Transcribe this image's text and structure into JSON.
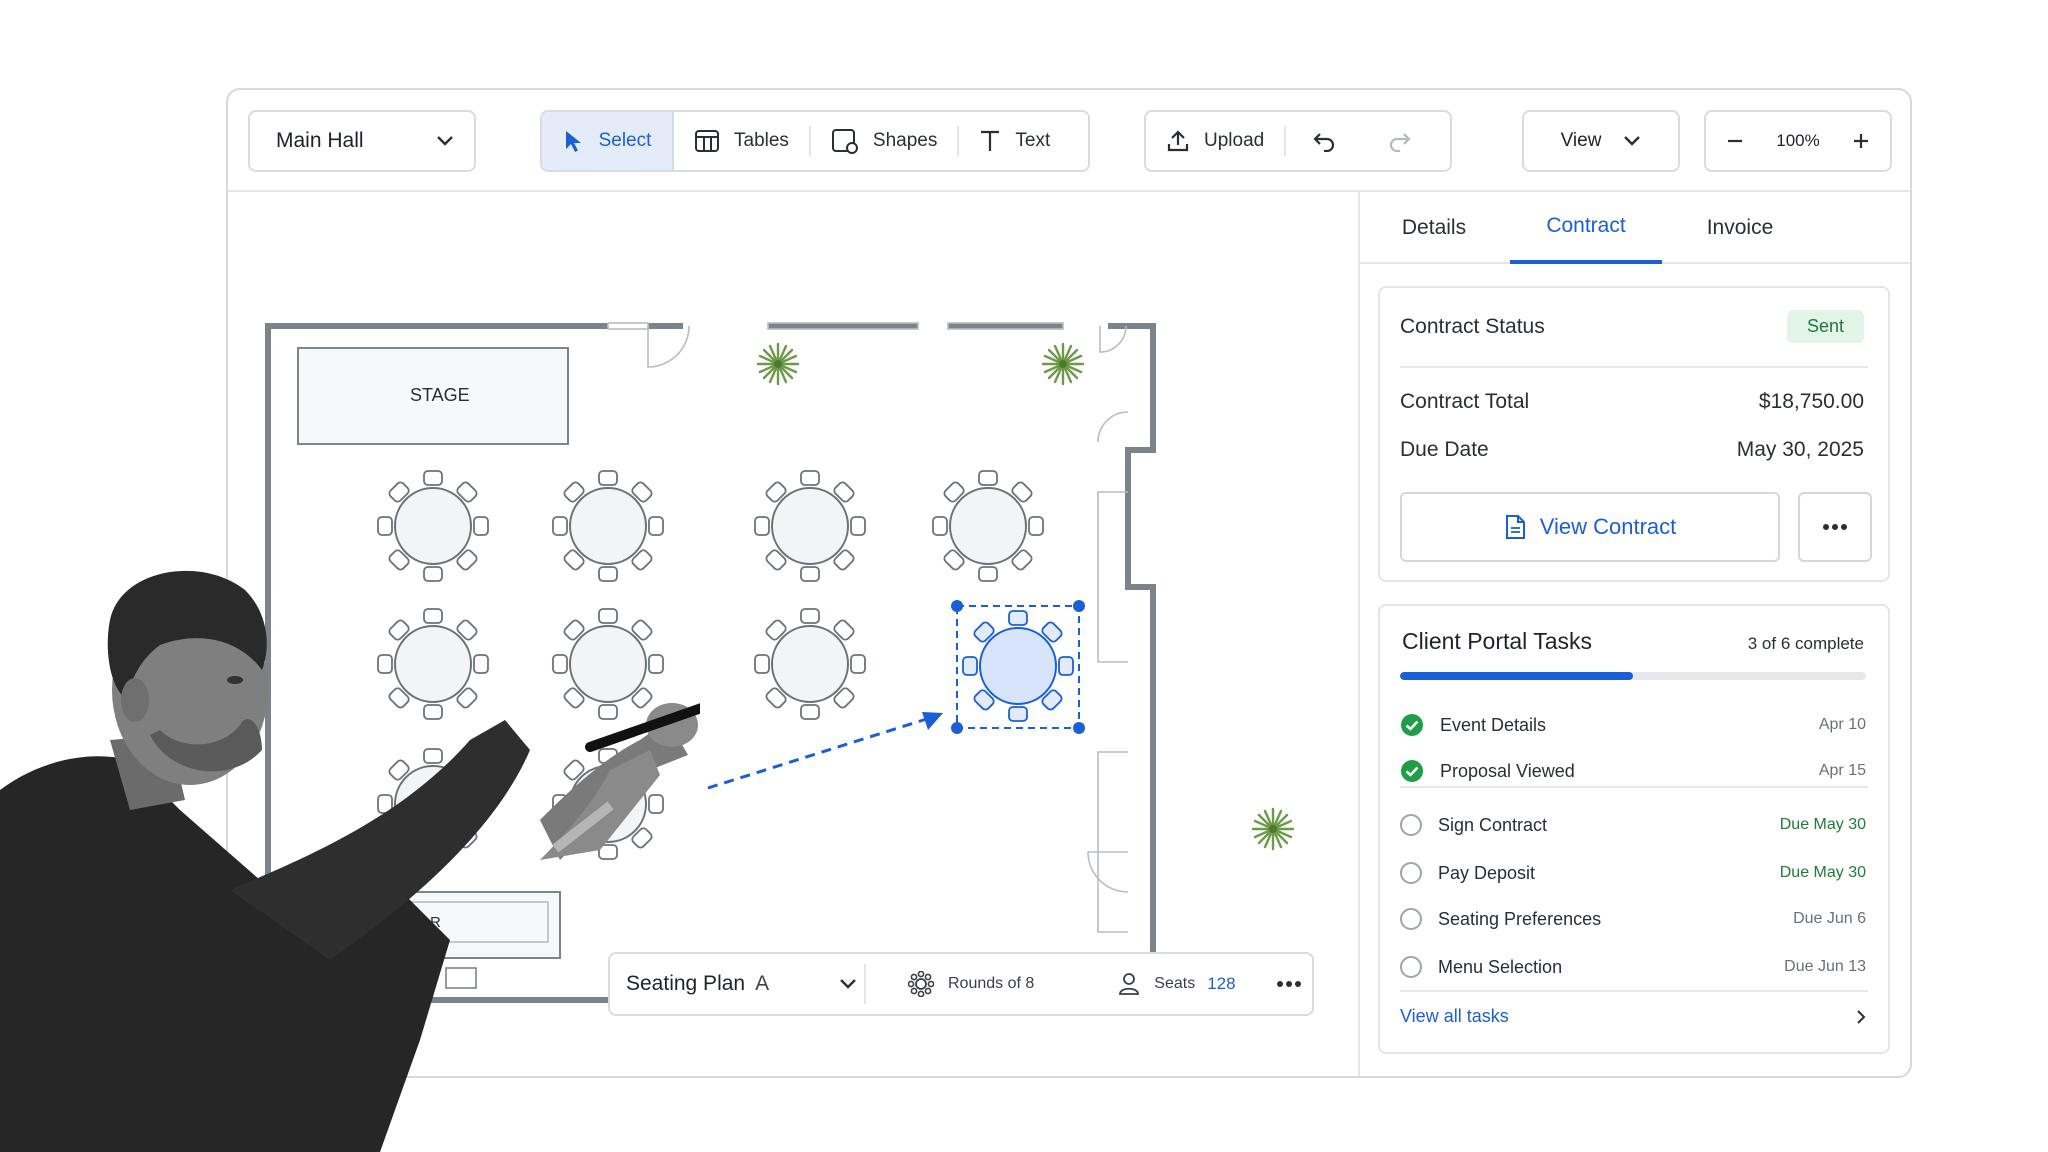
{
  "toolbar": {
    "hall_select": "Main Hall",
    "tools": [
      {
        "label": "Select",
        "icon": "cursor-arrow-icon",
        "active": true
      },
      {
        "label": "Tables",
        "icon": "table-grid-icon"
      },
      {
        "label": "Shapes",
        "icon": "shapes-icon"
      },
      {
        "label": "Text",
        "icon": "text-tool-icon"
      }
    ],
    "upload_label": "Upload",
    "undo_icon": "undo-icon",
    "redo_icon": "redo-icon",
    "view_label": "View",
    "zoom": "100%"
  },
  "floor_plan": {
    "stage_label": "STAGE",
    "bar_label": "BAR",
    "selected_table_color": "#1b5fd6"
  },
  "plan_bar": {
    "plan_name": "Seating Plan",
    "plan_variant": "A",
    "table_type": "Rounds of 8",
    "seats_label": "Seats",
    "seats_count": "128"
  },
  "panel": {
    "tabs": [
      "Details",
      "Contract",
      "Invoice"
    ],
    "active_tab": "Contract",
    "contract": {
      "status_label": "Contract Status",
      "status_value": "Sent",
      "total_label": "Contract Total",
      "total_value": "$18,750.00",
      "due_label": "Due Date",
      "due_value": "May 30, 2025",
      "view_button": "View Contract"
    },
    "tasks": {
      "title": "Client Portal Tasks",
      "count_text": "3 of 6 complete",
      "progress_fraction": 0.5,
      "items": [
        {
          "label": "Event Details",
          "date": "Apr 10",
          "done": true
        },
        {
          "label": "Proposal Viewed",
          "date": "Apr 15",
          "done": true
        },
        {
          "label": "Sign Contract",
          "date": "Due May 30",
          "done": false,
          "highlight": true
        },
        {
          "label": "Pay Deposit",
          "date": "Due May 30",
          "done": false,
          "highlight": true
        },
        {
          "label": "Seating Preferences",
          "date": "Due Jun 6",
          "done": false
        },
        {
          "label": "Menu Selection",
          "date": "Due Jun 13",
          "done": false
        }
      ],
      "view_all": "View all tasks"
    }
  },
  "colors": {
    "accent": "#1b5fd6",
    "success": "#1f7a3a",
    "success_bg": "#e3f4e8"
  }
}
